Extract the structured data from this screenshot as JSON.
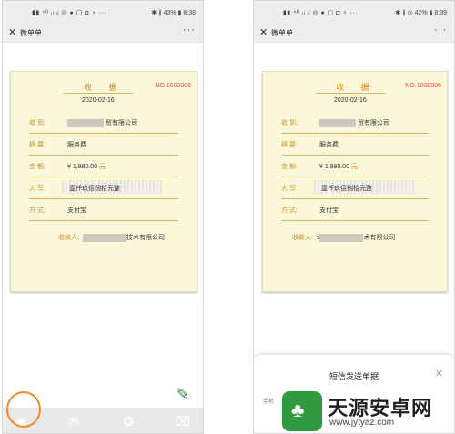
{
  "status": {
    "left_indicators": "▮▮ ⁴ᴳ ᵢₗ ᵢₗ ◎ ● ▢ ◘ ♀ ···",
    "right_left_phone": "✱ ∦ 43% ▮ 8:38",
    "right_right_phone": "✱ ∦ ◎ 42% ▮ 8:39"
  },
  "app": {
    "title": "微单单"
  },
  "receipt": {
    "title": "收 据",
    "number": "NO.1000006",
    "date": "2020-02-16",
    "rows": [
      {
        "label": "收  到:",
        "value_suffix_left": "贸有限公司",
        "value_suffix_right": "贸有限公司"
      },
      {
        "label": "摘  要:",
        "value": "服务费"
      },
      {
        "label": "金  额:",
        "value": "¥ 1,980.00",
        "unit": "元"
      },
      {
        "label": "大  写:",
        "value": "壹仟玖佰捌拾元整"
      },
      {
        "label": "方  式:",
        "value": "支付宝"
      }
    ],
    "payee_label": "收款人:",
    "payee_left_suffix": "技术有限公司",
    "payee_right_prefix": "s",
    "payee_right_suffix": "术有限公司"
  },
  "toolbar": {
    "icons": [
      "chat-bubble-icon",
      "mail-icon",
      "wechat-icon",
      "share-icon"
    ]
  },
  "sms_sheet": {
    "title": "短信发送单据",
    "phone_hint": "手机"
  },
  "watermark": {
    "title": "天源安卓网",
    "url": "www.jytyaz.com"
  },
  "colors": {
    "receipt_bg": "#fbf7d9",
    "accent": "#d08a1c",
    "number": "#e0503c",
    "annotation": "#f08a2a"
  }
}
